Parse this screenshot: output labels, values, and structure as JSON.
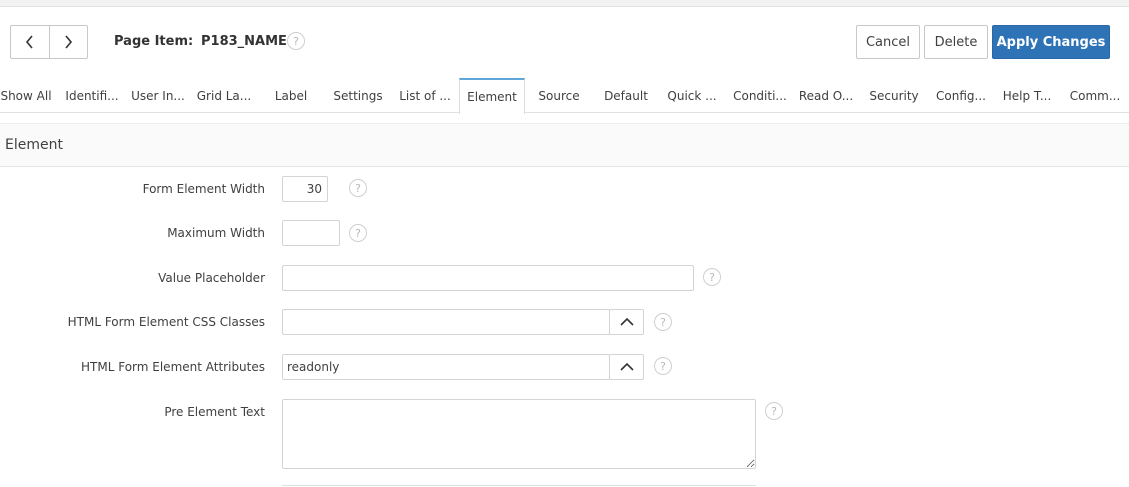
{
  "header": {
    "page_item_label": "Page Item:",
    "page_item_name": "P183_NAME",
    "help_glyph": "?",
    "cancel_label": "Cancel",
    "delete_label": "Delete",
    "apply_label": "Apply Changes",
    "accent_color": "#2f73b7"
  },
  "tabs": [
    {
      "label": "Show All"
    },
    {
      "label": "Identifi..."
    },
    {
      "label": "User In..."
    },
    {
      "label": "Grid La..."
    },
    {
      "label": "Label"
    },
    {
      "label": "Settings"
    },
    {
      "label": "List of ..."
    },
    {
      "label": "Element",
      "active": true
    },
    {
      "label": "Source"
    },
    {
      "label": "Default"
    },
    {
      "label": "Quick ..."
    },
    {
      "label": "Conditi..."
    },
    {
      "label": "Read O..."
    },
    {
      "label": "Security"
    },
    {
      "label": "Config..."
    },
    {
      "label": "Help T..."
    },
    {
      "label": "Comm..."
    }
  ],
  "section": {
    "title": "Element"
  },
  "form": {
    "form_element_width": {
      "label": "Form Element Width",
      "value": "30"
    },
    "maximum_width": {
      "label": "Maximum Width",
      "value": ""
    },
    "value_placeholder": {
      "label": "Value Placeholder",
      "value": ""
    },
    "css_classes": {
      "label": "HTML Form Element CSS Classes",
      "value": ""
    },
    "attributes": {
      "label": "HTML Form Element Attributes",
      "value": "readonly"
    },
    "pre_element_text": {
      "label": "Pre Element Text",
      "value": ""
    }
  }
}
